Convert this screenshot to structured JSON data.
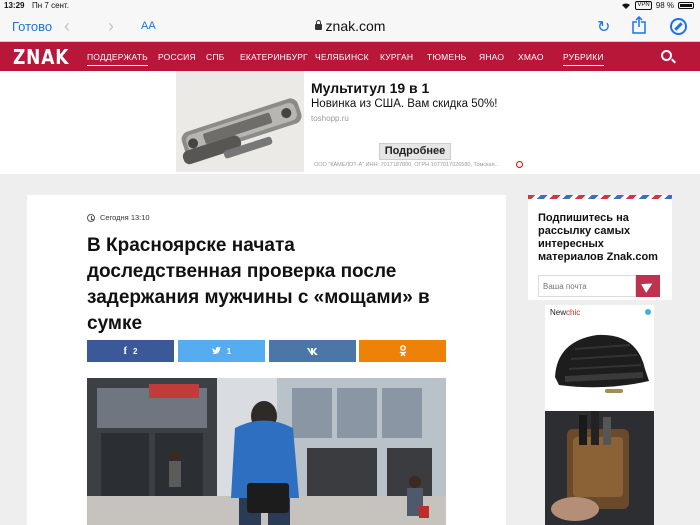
{
  "status": {
    "time": "13:29",
    "date": "Пн 7 сент.",
    "vpn": "VPN",
    "battery": "98 %"
  },
  "toolbar": {
    "done_label": "Готово",
    "text_size_label": "AA",
    "url": "znak.com"
  },
  "site": {
    "logo": "ZNAK",
    "nav": [
      "ПОДДЕРЖАТЬ",
      "РОССИЯ",
      "СПБ",
      "ЕКАТЕРИНБУРГ",
      "ЧЕЛЯБИНСК",
      "КУРГАН",
      "ТЮМЕНЬ",
      "ЯНАО",
      "ХМАО",
      "РУБРИКИ"
    ]
  },
  "ad": {
    "title": "Мультитул 19 в 1",
    "subtitle": "Новинка из США. Вам скидка 50%!",
    "domain": "toshopp.ru",
    "button": "Подробнее",
    "legal": "ООО \"КАМЕЛОТ-А\" ИНН: 7017187800, ОГРН 1077017026580, Томская..."
  },
  "article": {
    "date": "Сегодня 13:10",
    "headline": "В Красноярске начата доследственная проверка после задержания мужчины с «мощами» в сумке",
    "share": {
      "facebook_count": "2",
      "twitter_count": "1"
    }
  },
  "subscribe": {
    "title": "Подпишитесь на рассылку самых интересных материалов Znak.com",
    "placeholder": "Ваша почта"
  },
  "ad2": {
    "brand_prefix": "New",
    "brand_suffix": "chic"
  }
}
